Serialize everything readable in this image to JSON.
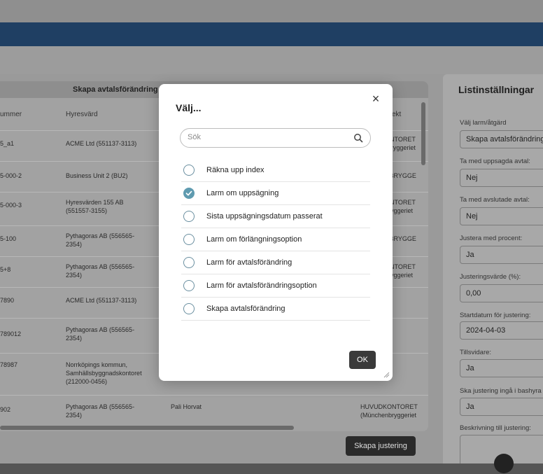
{
  "table": {
    "title": "Skapa avtalsförändring",
    "columns": [
      "ummer",
      "Hyresvärd",
      "ekt"
    ],
    "rows": [
      {
        "nr": "5_a1",
        "landlord": "ACME Ltd (551137-3113)",
        "object": "ONTORET\nbryggeriet"
      },
      {
        "nr": "5-000-2",
        "landlord": "Business Unit 2 (BU2)",
        "object": "NBRYGGE"
      },
      {
        "nr": "5-000-3",
        "landlord": "Hyresvärden 155 AB\n(551557-3155)",
        "object": "ONTORET\nbryggeriet"
      },
      {
        "nr": "5-100",
        "landlord": "Pythagoras AB (556565-\n2354)",
        "object": "NBRYGGE"
      },
      {
        "nr": "5+8",
        "landlord": "Pythagoras AB (556565-\n2354)",
        "object": "ONTORET\nbryggeriet"
      },
      {
        "nr": "7890",
        "landlord": "ACME Ltd (551137-3113)",
        "object": ""
      },
      {
        "nr": "789012",
        "landlord": "Pythagoras AB (556565-\n2354)",
        "object": ""
      },
      {
        "nr": "78987",
        "landlord": "Norrköpings kommun,\nSamhällsbyggnadskontoret\n(212000-0456)",
        "object": ""
      },
      {
        "nr": "902",
        "landlord": "Pythagoras AB (556565-\n2354)",
        "tenant": "Pali Horvat",
        "object": "HUVUDKONTORET\n(Münchenbryggeriet"
      }
    ],
    "create_button": "Skapa justering"
  },
  "settings": {
    "title": "Listinställningar",
    "fields": [
      {
        "label": "Välj larm/åtgärd",
        "value": "Skapa avtalsförändring"
      },
      {
        "label": "Ta med uppsagda avtal:",
        "value": "Nej"
      },
      {
        "label": "Ta med avslutade avtal:",
        "value": "Nej"
      },
      {
        "label": "Justera med procent:",
        "value": "Ja"
      },
      {
        "label": "Justeringsvärde (%):",
        "value": "0,00"
      },
      {
        "label": "Startdatum för justering:",
        "value": "2024-04-03"
      },
      {
        "label": "Tillsvidare:",
        "value": "Ja"
      },
      {
        "label": "Ska justering ingå i bashyra",
        "value": "Ja"
      },
      {
        "label": "Beskrivning till justering:",
        "value": ""
      }
    ]
  },
  "modal": {
    "title": "Välj...",
    "close": "×",
    "search_placeholder": "Sök",
    "options": [
      {
        "label": "Räkna upp index",
        "checked": false
      },
      {
        "label": "Larm om uppsägning",
        "checked": true
      },
      {
        "label": "Sista uppsägningsdatum passerat",
        "checked": false
      },
      {
        "label": "Larm om förlängningsoption",
        "checked": false
      },
      {
        "label": "Larm för avtalsförändring",
        "checked": false
      },
      {
        "label": "Larm för avtalsförändringsoption",
        "checked": false
      },
      {
        "label": "Skapa avtalsförändring",
        "checked": false
      }
    ],
    "ok_label": "OK"
  }
}
